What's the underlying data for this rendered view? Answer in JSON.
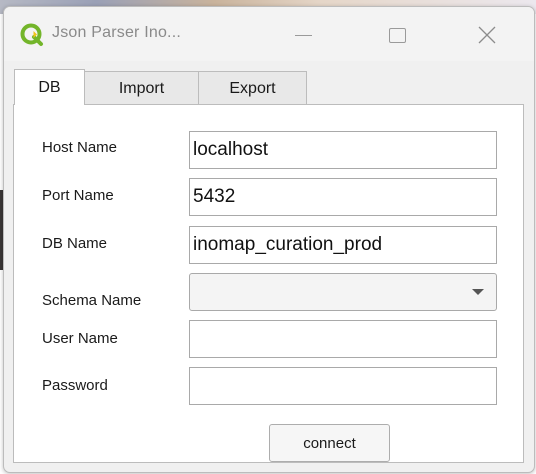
{
  "window": {
    "title": "Json Parser Ino...",
    "controls": {
      "minimize": "minimize-icon",
      "maximize": "maximize-icon",
      "close": "close-icon"
    }
  },
  "tabs": [
    {
      "label": "DB",
      "active": true
    },
    {
      "label": "Import",
      "active": false
    },
    {
      "label": "Export",
      "active": false
    }
  ],
  "form": {
    "host_label": "Host Name",
    "host_value": "localhost",
    "port_label": "Port Name",
    "port_value": "5432",
    "db_label": "DB Name",
    "db_value": "inomap_curation_prod",
    "schema_label": "Schema Name",
    "schema_value": "",
    "user_label": "User Name",
    "user_value": "",
    "password_label": "Password",
    "password_value": ""
  },
  "connect_label": "connect",
  "colors": {
    "app_icon_green": "#73b52a",
    "window_bg": "#f0f0f0",
    "panel_bg": "#ffffff",
    "border": "#bcbcbc"
  }
}
